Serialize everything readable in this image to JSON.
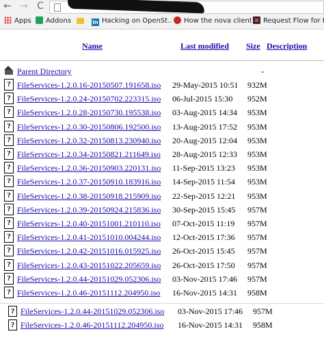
{
  "browser": {
    "nav_back": "←",
    "nav_forward": "→",
    "nav_reload": "C"
  },
  "bookmarks": [
    {
      "label": "Apps",
      "icon": "apps-grid-icon"
    },
    {
      "label": "Addons",
      "icon": "puzzle-icon"
    },
    {
      "label": "",
      "icon": "folder-icon"
    },
    {
      "label": "Hacking on OpenSt...",
      "icon": "linkedin-icon"
    },
    {
      "label": "How the nova client...",
      "icon": "nova-icon"
    },
    {
      "label": "Request Flow for Pr...",
      "icon": "request-flow-icon"
    }
  ],
  "listing": {
    "headers": {
      "name": "Name",
      "last_modified": "Last modified",
      "size": "Size",
      "description": "Description"
    },
    "parent": {
      "label": "Parent Directory",
      "size": "-"
    },
    "files": [
      {
        "name": "FileServices-1.2.0.16-20150507.191658.iso",
        "modified": "29-May-2015 10:51",
        "size": "932M"
      },
      {
        "name": "FileServices-1.2.0.24-20150702.223315.iso",
        "modified": "06-Jul-2015 15:30",
        "size": "952M"
      },
      {
        "name": "FileServices-1.2.0.28-20150730.195538.iso",
        "modified": "03-Aug-2015 14:34",
        "size": "953M"
      },
      {
        "name": "FileServices-1.2.0.30-20150806.192500.iso",
        "modified": "13-Aug-2015 17:52",
        "size": "953M"
      },
      {
        "name": "FileServices-1.2.0.32-20150813.230940.iso",
        "modified": "20-Aug-2015 12:04",
        "size": "953M"
      },
      {
        "name": "FileServices-1.2.0.34-20150821.211649.iso",
        "modified": "28-Aug-2015 12:33",
        "size": "953M"
      },
      {
        "name": "FileServices-1.2.0.36-20150903.220131.iso",
        "modified": "11-Sep-2015 13:23",
        "size": "953M"
      },
      {
        "name": "FileServices-1.2.0.37-20150910.183916.iso",
        "modified": "14-Sep-2015 11:54",
        "size": "953M"
      },
      {
        "name": "FileServices-1.2.0.38-20150918.215909.iso",
        "modified": "22-Sep-2015 12:21",
        "size": "953M"
      },
      {
        "name": "FileServices-1.2.0.39-20150924.215836.iso",
        "modified": "30-Sep-2015 15:45",
        "size": "957M"
      },
      {
        "name": "FileServices-1.2.0.40-20151001.210110.iso",
        "modified": "07-Oct-2015 11:19",
        "size": "957M"
      },
      {
        "name": "FileServices-1.2.0.41-20151010.004244.iso",
        "modified": "12-Oct-2015 17:36",
        "size": "957M"
      },
      {
        "name": "FileServices-1.2.0.42-20151016.015925.iso",
        "modified": "26-Oct-2015 15:45",
        "size": "957M"
      },
      {
        "name": "FileServices-1.2.0.43-20151022.205659.iso",
        "modified": "26-Oct-2015 17:50",
        "size": "957M"
      },
      {
        "name": "FileServices-1.2.0.44-20151029.052306.iso",
        "modified": "03-Nov-2015 17:46",
        "size": "957M"
      },
      {
        "name": "FileServices-1.2.0.46-20151112.204950.iso",
        "modified": "16-Nov-2015 14:31",
        "size": "958M"
      }
    ],
    "fragment": [
      {
        "name": "FileServices-1.2.0.44-20151029.052306.iso",
        "modified": "03-Nov-2015 17:46",
        "size": "957M"
      },
      {
        "name": "FileServices-1.2.0.46-20151112.204950.iso",
        "modified": "16-Nov-2015 14:31",
        "size": "958M"
      }
    ]
  },
  "colors": {
    "link": "#1a0dab",
    "chrome": "#f2f2f2"
  }
}
